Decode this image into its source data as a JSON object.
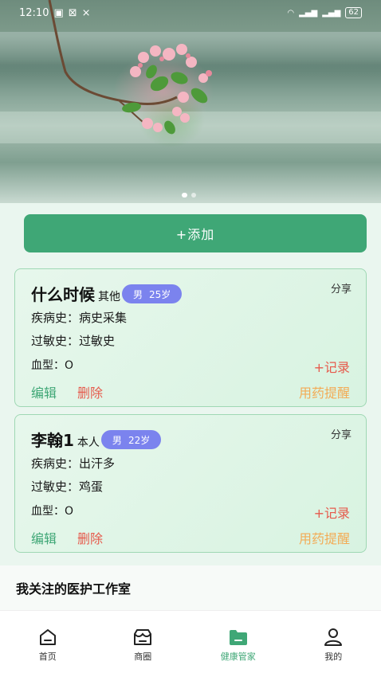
{
  "status_bar": {
    "time": "12:10",
    "battery": "62",
    "icons": [
      "message-icon",
      "notification-icon",
      "mute-icon",
      "wifi-icon",
      "signal-icon",
      "signal-icon",
      "battery-icon"
    ]
  },
  "banner": {
    "image_alt": "flowering branch",
    "slide_count": 2,
    "active_slide": 1
  },
  "add_button": {
    "label": "+添加"
  },
  "cards": [
    {
      "name": "什么时候",
      "relation": "其他",
      "gender": "男",
      "age": "25岁",
      "share": "分享",
      "disease_history": "疾病史：病史采集",
      "allergy_history": "过敏史：过敏史",
      "blood_type": "血型：O",
      "record": "+记录",
      "edit": "编辑",
      "delete": "删除",
      "reminder": "用药提醒"
    },
    {
      "name": "李翰1",
      "relation": "本人",
      "gender": "男",
      "age": "22岁",
      "share": "分享",
      "disease_history": "疾病史：出汗多",
      "allergy_history": "过敏史：鸡蛋",
      "blood_type": "血型：O",
      "record": "+记录",
      "edit": "编辑",
      "delete": "删除",
      "reminder": "用药提醒"
    }
  ],
  "followed_section": {
    "title": "我关注的医护工作室"
  },
  "tabbar": {
    "items": [
      {
        "label": "首页",
        "icon": "home-icon"
      },
      {
        "label": "商圈",
        "icon": "store-icon"
      },
      {
        "label": "健康管家",
        "icon": "folder-icon"
      },
      {
        "label": "我的",
        "icon": "user-icon"
      }
    ],
    "active_index": 2
  },
  "colors": {
    "accent": "#3fa776",
    "danger": "#e65a4c",
    "warning": "#f3ab55",
    "pill": "#7b83ee"
  }
}
